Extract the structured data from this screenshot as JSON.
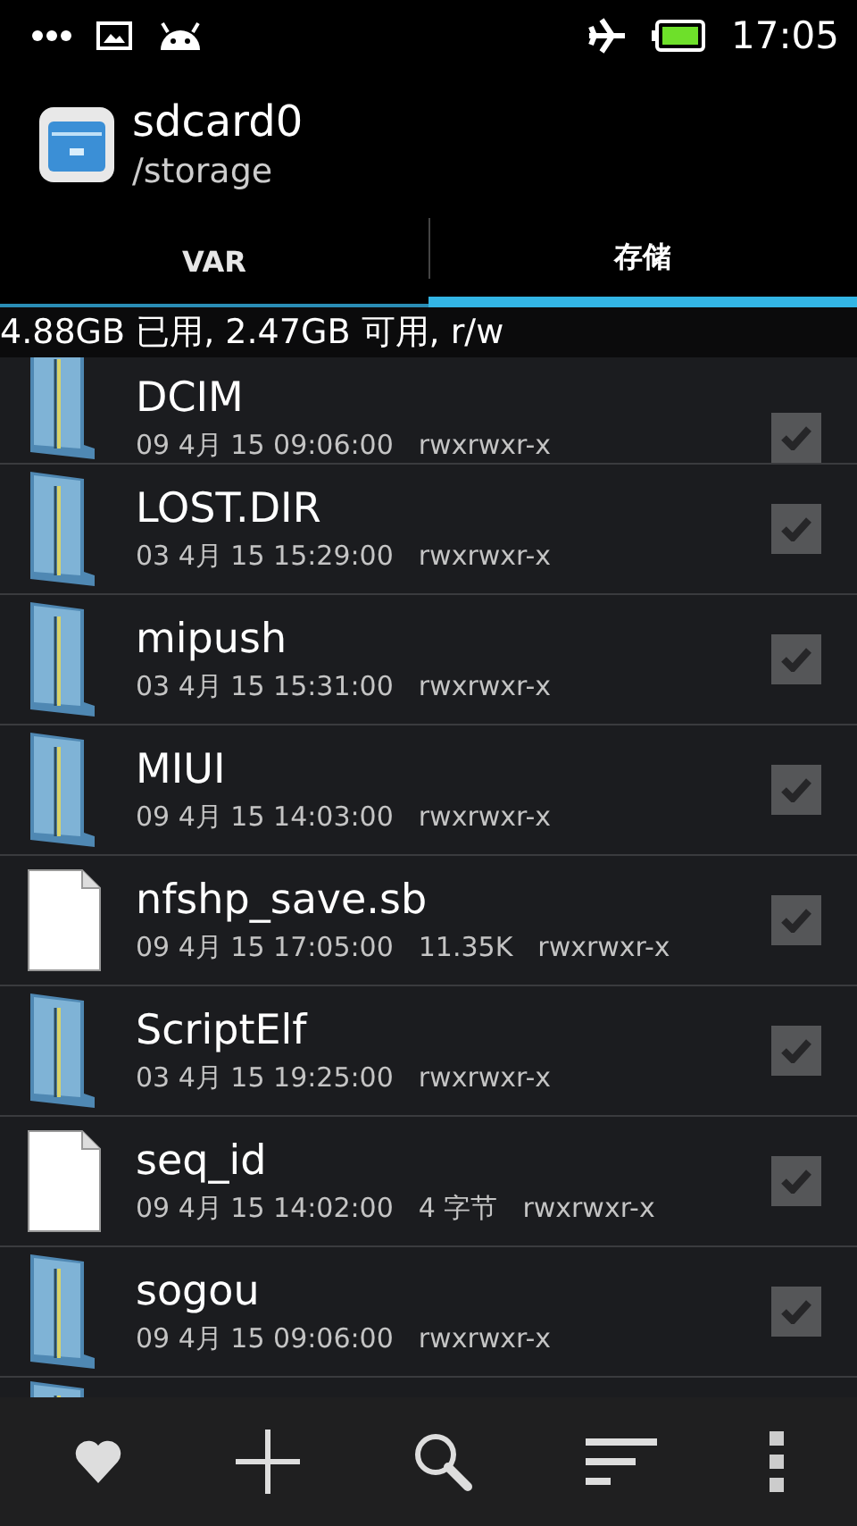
{
  "status_bar": {
    "time": "17:05"
  },
  "header": {
    "title": "sdcard0",
    "path": "/storage"
  },
  "tabs": [
    {
      "label": "VAR",
      "selected": false
    },
    {
      "label": "存储",
      "selected": true
    }
  ],
  "storage_info": "4.88GB 已用, 2.47GB 可用, r/w",
  "files": [
    {
      "kind": "folder",
      "name": "DCIM",
      "date": "09 4月 15 09:06:00",
      "permissions": "rwxrwxr-x",
      "checked": true
    },
    {
      "kind": "folder",
      "name": "LOST.DIR",
      "date": "03 4月 15 15:29:00",
      "permissions": "rwxrwxr-x",
      "checked": true
    },
    {
      "kind": "folder",
      "name": "mipush",
      "date": "03 4月 15 15:31:00",
      "permissions": "rwxrwxr-x",
      "checked": true
    },
    {
      "kind": "folder",
      "name": "MIUI",
      "date": "09 4月 15 14:03:00",
      "permissions": "rwxrwxr-x",
      "checked": true
    },
    {
      "kind": "file",
      "name": "nfshp_save.sb",
      "date": "09 4月 15 17:05:00",
      "size": "11.35K",
      "permissions": "rwxrwxr-x",
      "checked": true
    },
    {
      "kind": "folder",
      "name": "ScriptElf",
      "date": "03 4月 15 19:25:00",
      "permissions": "rwxrwxr-x",
      "checked": true
    },
    {
      "kind": "file",
      "name": "seq_id",
      "date": "09 4月 15 14:02:00",
      "size": "4 字节",
      "permissions": "rwxrwxr-x",
      "checked": true
    },
    {
      "kind": "folder",
      "name": "sogou",
      "date": "09 4月 15 09:06:00",
      "permissions": "rwxrwxr-x",
      "checked": true
    },
    {
      "kind": "folder"
    }
  ]
}
